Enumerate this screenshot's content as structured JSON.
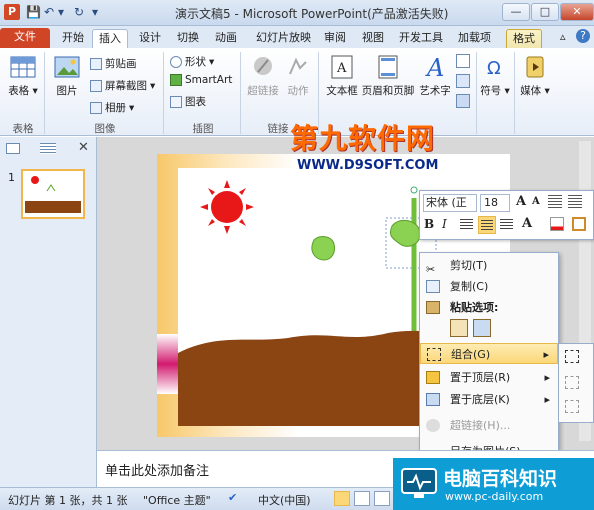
{
  "window": {
    "title": "演示文稿5 - Microsoft PowerPoint(产品激活失败)",
    "app_icon": "P",
    "minimize": "—",
    "restore": "□",
    "close": "✕"
  },
  "tabs": [
    {
      "label": "文件"
    },
    {
      "label": "开始"
    },
    {
      "label": "插入"
    },
    {
      "label": "设计"
    },
    {
      "label": "切换"
    },
    {
      "label": "动画"
    },
    {
      "label": "幻灯片放映"
    },
    {
      "label": "审阅"
    },
    {
      "label": "视图"
    },
    {
      "label": "开发工具"
    },
    {
      "label": "加载项"
    },
    {
      "label": "格式"
    }
  ],
  "ribbon": {
    "table": "表格",
    "picture": "图片",
    "clipart": "剪贴画",
    "screenshot": "屏幕截图",
    "album": "相册",
    "shapes": "形状",
    "smartart": "SmartArt",
    "chart": "图表",
    "hyperlink": "超链接",
    "action": "动作",
    "textbox": "文本框",
    "header_footer": "页眉和页脚",
    "wordart": "艺术字",
    "symbol": "符号",
    "media": "媒体",
    "group_table": "表格",
    "group_image": "图像",
    "group_illustration": "插图",
    "group_links": "链接"
  },
  "slides_panel": {
    "slide_number": "1"
  },
  "notes": {
    "placeholder": "单击此处添加备注"
  },
  "status": {
    "slide_info": "幻灯片 第 1 张，共 1 张",
    "theme": "\"Office 主题\"",
    "language": "中文(中国)"
  },
  "mini_toolbar": {
    "font": "宋体 (正",
    "size": "18",
    "grow": "A",
    "shrink": "A",
    "bold": "B",
    "italic": "I",
    "color_a": "A"
  },
  "context_menu": {
    "items": [
      {
        "label": "剪切(T)",
        "disabled": false
      },
      {
        "label": "复制(C)",
        "disabled": false
      },
      {
        "label": "粘贴选项:",
        "disabled": false
      },
      {
        "label": "组合(G)",
        "disabled": false
      },
      {
        "label": "置于顶层(R)",
        "disabled": false
      },
      {
        "label": "置于底层(K)",
        "disabled": false
      },
      {
        "label": "超链接(H)...",
        "disabled": true
      },
      {
        "label": "另存为图片(S)...",
        "disabled": false
      }
    ]
  },
  "watermarks": {
    "brand": "第九软件网",
    "brand_url": "WWW.D9SOFT.COM",
    "site": "电脑百科知识",
    "site_url": "www.pc-daily.com"
  },
  "colors": {
    "file_tab": "#d04526",
    "ribbon_bg": "#e7eef8",
    "soil": "#8b4513",
    "sun": "#e81818",
    "leaf": "#7fcf4a",
    "highlight": "#fbd778"
  }
}
